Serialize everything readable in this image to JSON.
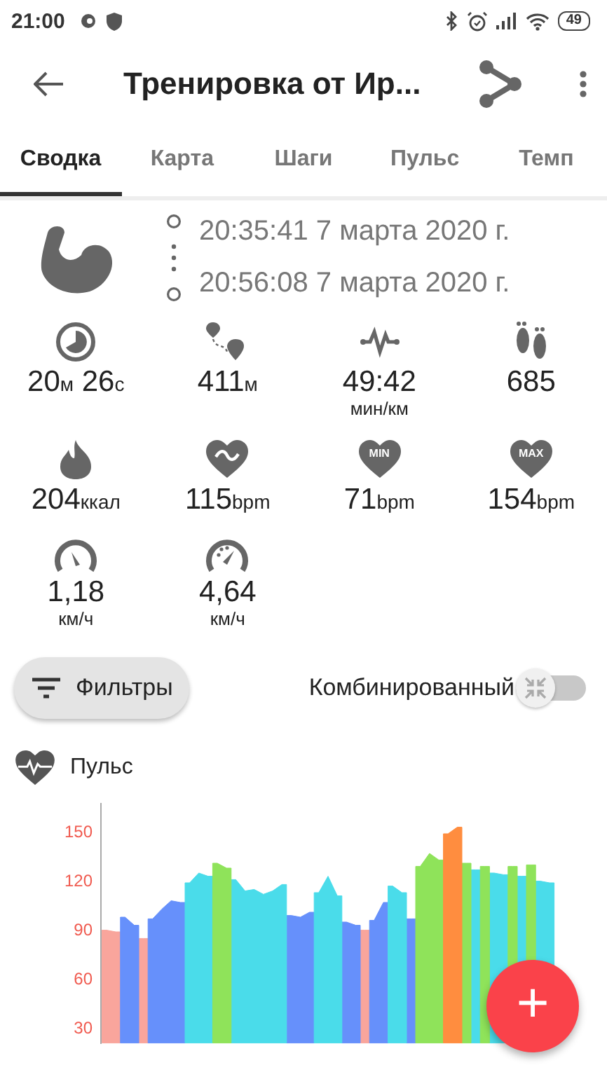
{
  "status_bar": {
    "time": "21:00",
    "battery": "49"
  },
  "toolbar": {
    "title": "Тренировка от Ир..."
  },
  "tabs": [
    {
      "label": "Сводка",
      "selected": true
    },
    {
      "label": "Карта",
      "selected": false
    },
    {
      "label": "Шаги",
      "selected": false
    },
    {
      "label": "Пульс",
      "selected": false
    },
    {
      "label": "Темп",
      "selected": false
    }
  ],
  "workout": {
    "start": "20:35:41 7 марта 2020 г.",
    "end": "20:56:08 7 марта 2020 г."
  },
  "stats": [
    {
      "value": "20",
      "unit": "м",
      "value2": "26",
      "unit2": "с",
      "kind": "duration"
    },
    {
      "value": "411",
      "unit": "м",
      "kind": "inline"
    },
    {
      "value": "49:42",
      "unit": "мин/км",
      "kind": "below"
    },
    {
      "value": "685",
      "kind": "plain"
    },
    {
      "value": "204",
      "unit": "ккал",
      "kind": "inline"
    },
    {
      "value": "115",
      "unit": "bpm",
      "kind": "inline"
    },
    {
      "value": "71",
      "unit": "bpm",
      "kind": "inline",
      "icon_text": "MIN"
    },
    {
      "value": "154",
      "unit": "bpm",
      "kind": "inline",
      "icon_text": "MAX"
    },
    {
      "value": "1,18",
      "unit": "км/ч",
      "kind": "below"
    },
    {
      "value": "4,64",
      "unit": "км/ч",
      "kind": "below"
    }
  ],
  "filter_button": {
    "label": "Фильтры"
  },
  "combined_toggle": {
    "label": "Комбинированный",
    "on": false
  },
  "pulse": {
    "title": "Пульс",
    "y_ticks": [
      "150",
      "120",
      "90",
      "60",
      "30"
    ]
  },
  "fab": {
    "label": "+"
  }
}
